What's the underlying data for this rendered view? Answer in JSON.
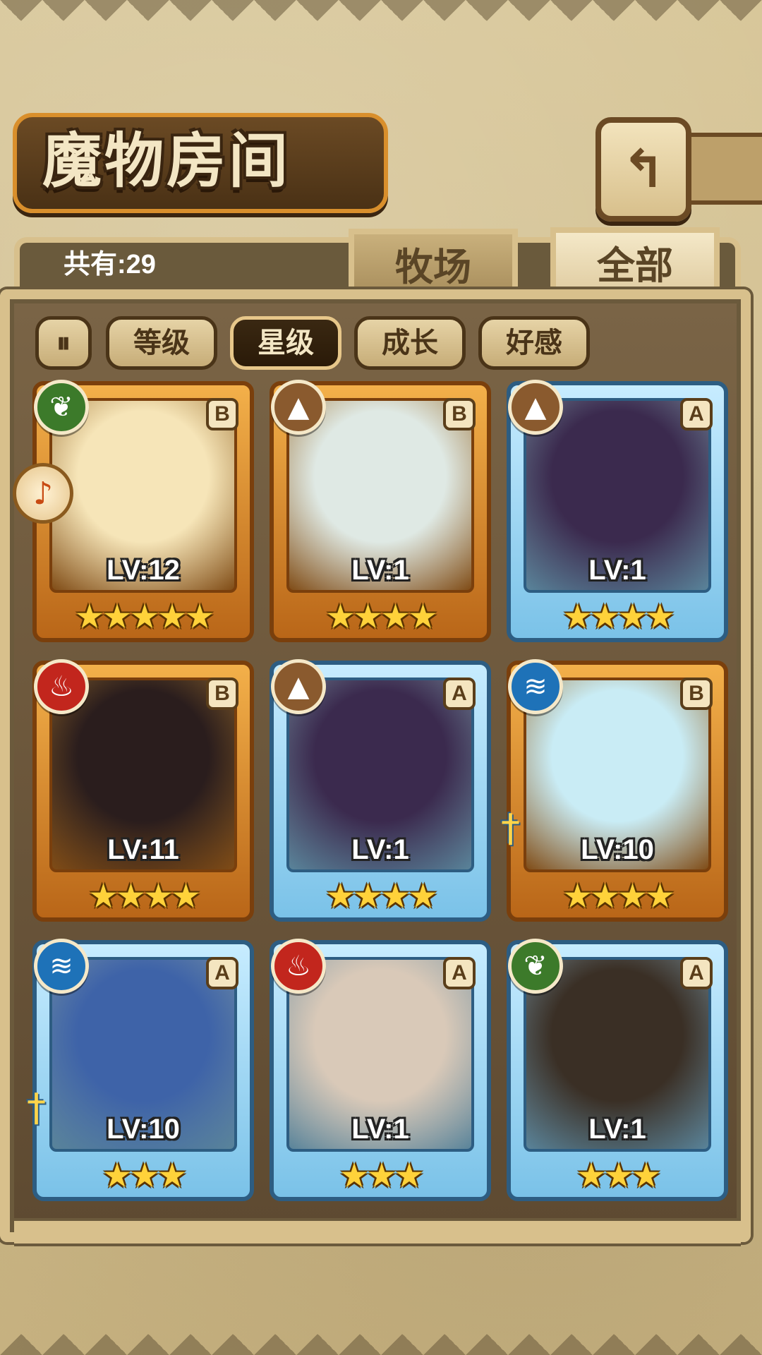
{
  "title": "魔物房间",
  "back_button": {
    "icon": "return-arrow-icon",
    "glyph": "↰"
  },
  "count_text": "共有:29",
  "tabs": [
    {
      "label": "牧场",
      "active": false
    },
    {
      "label": "全部",
      "active": true
    }
  ],
  "sort": {
    "toggle_icon": "sort-order-icon",
    "toggle_glyph": "⏸",
    "buttons": [
      {
        "label": "等级",
        "active": false
      },
      {
        "label": "星级",
        "active": true
      },
      {
        "label": "成长",
        "active": false
      },
      {
        "label": "好感",
        "active": false
      }
    ]
  },
  "favorite_badge": {
    "icon": "favorite-tag-icon",
    "glyph": "♪"
  },
  "monsters": [
    {
      "frame": "gold",
      "element": "nature",
      "element_color": "#3c7a2a",
      "element_glyph": "❦",
      "rank": "B",
      "level": "LV:12",
      "stars": 5,
      "weapon": false
    },
    {
      "frame": "gold",
      "element": "earth",
      "element_color": "#8a5a2e",
      "element_glyph": "▲",
      "rank": "B",
      "level": "LV:1",
      "stars": 4,
      "weapon": false
    },
    {
      "frame": "blue",
      "element": "earth",
      "element_color": "#8a5a2e",
      "element_glyph": "▲",
      "rank": "A",
      "level": "LV:1",
      "stars": 4,
      "weapon": false
    },
    {
      "frame": "gold",
      "element": "fire",
      "element_color": "#c2261d",
      "element_glyph": "♨",
      "rank": "B",
      "level": "LV:11",
      "stars": 4,
      "weapon": false
    },
    {
      "frame": "blue",
      "element": "earth",
      "element_color": "#8a5a2e",
      "element_glyph": "▲",
      "rank": "A",
      "level": "LV:1",
      "stars": 4,
      "weapon": false
    },
    {
      "frame": "gold",
      "element": "water",
      "element_color": "#1e72b8",
      "element_glyph": "≋",
      "rank": "B",
      "level": "LV:10",
      "stars": 4,
      "weapon": true
    },
    {
      "frame": "blue",
      "element": "water",
      "element_color": "#1e72b8",
      "element_glyph": "≋",
      "rank": "A",
      "level": "LV:10",
      "stars": 3,
      "weapon": true
    },
    {
      "frame": "blue",
      "element": "fire",
      "element_color": "#c2261d",
      "element_glyph": "♨",
      "rank": "A",
      "level": "LV:1",
      "stars": 3,
      "weapon": false
    },
    {
      "frame": "blue",
      "element": "nature",
      "element_color": "#3c7a2a",
      "element_glyph": "❦",
      "rank": "A",
      "level": "LV:1",
      "stars": 3,
      "weapon": false
    }
  ],
  "art_colors": [
    "#f6e5b8",
    "#dfe9e4",
    "#3b2a4e",
    "#2a1d1d",
    "#3b2a4e",
    "#c9ecf5",
    "#3e63a8",
    "#d9c9b8",
    "#3a2f25"
  ]
}
